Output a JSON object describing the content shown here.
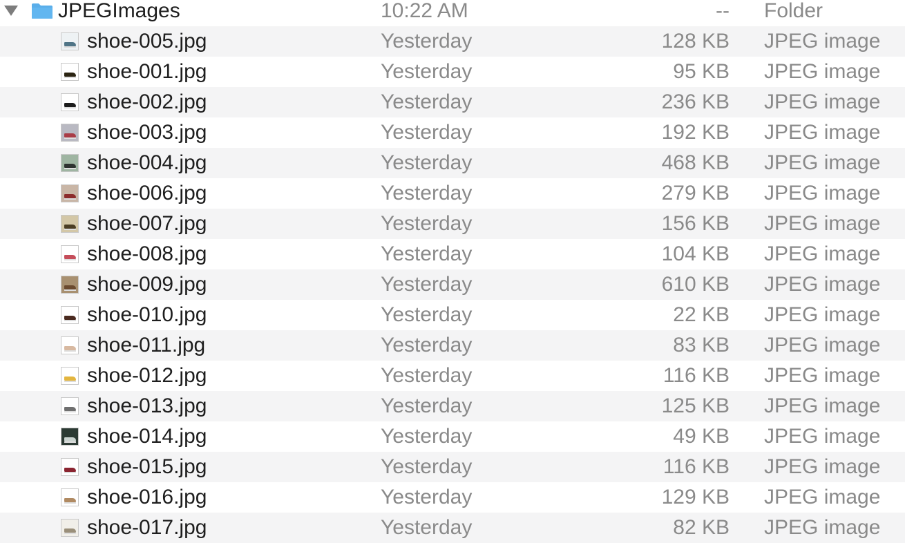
{
  "folder": {
    "name": "JPEGImages",
    "date": "10:22 AM",
    "size": "--",
    "kind": "Folder",
    "icon": "folder-icon",
    "icon_color": "#62b6f0"
  },
  "files": [
    {
      "name": "shoe-005.jpg",
      "date": "Yesterday",
      "size": "128 KB",
      "kind": "JPEG image",
      "thumb_bg": "#eef2f4",
      "thumb_color": "#4f7486"
    },
    {
      "name": "shoe-001.jpg",
      "date": "Yesterday",
      "size": "95 KB",
      "kind": "JPEG image",
      "thumb_bg": "#ffffff",
      "thumb_color": "#2b2412"
    },
    {
      "name": "shoe-002.jpg",
      "date": "Yesterday",
      "size": "236 KB",
      "kind": "JPEG image",
      "thumb_bg": "#ffffff",
      "thumb_color": "#1d1d1d"
    },
    {
      "name": "shoe-003.jpg",
      "date": "Yesterday",
      "size": "192 KB",
      "kind": "JPEG image",
      "thumb_bg": "#b9b9c2",
      "thumb_color": "#a93c46"
    },
    {
      "name": "shoe-004.jpg",
      "date": "Yesterday",
      "size": "468 KB",
      "kind": "JPEG image",
      "thumb_bg": "#9fb5a2",
      "thumb_color": "#2e3230"
    },
    {
      "name": "shoe-006.jpg",
      "date": "Yesterday",
      "size": "279 KB",
      "kind": "JPEG image",
      "thumb_bg": "#c9b6a6",
      "thumb_color": "#8c2c2c"
    },
    {
      "name": "shoe-007.jpg",
      "date": "Yesterday",
      "size": "156 KB",
      "kind": "JPEG image",
      "thumb_bg": "#d3c7a7",
      "thumb_color": "#4a3d24"
    },
    {
      "name": "shoe-008.jpg",
      "date": "Yesterday",
      "size": "104 KB",
      "kind": "JPEG image",
      "thumb_bg": "#ffffff",
      "thumb_color": "#c54d5a"
    },
    {
      "name": "shoe-009.jpg",
      "date": "Yesterday",
      "size": "610 KB",
      "kind": "JPEG image",
      "thumb_bg": "#a89070",
      "thumb_color": "#6b4a2f"
    },
    {
      "name": "shoe-010.jpg",
      "date": "Yesterday",
      "size": "22 KB",
      "kind": "JPEG image",
      "thumb_bg": "#ffffff",
      "thumb_color": "#4a2a1f"
    },
    {
      "name": "shoe-011.jpg",
      "date": "Yesterday",
      "size": "83 KB",
      "kind": "JPEG image",
      "thumb_bg": "#ffffff",
      "thumb_color": "#d8b9a1"
    },
    {
      "name": "shoe-012.jpg",
      "date": "Yesterday",
      "size": "116 KB",
      "kind": "JPEG image",
      "thumb_bg": "#ffffff",
      "thumb_color": "#e3b53e"
    },
    {
      "name": "shoe-013.jpg",
      "date": "Yesterday",
      "size": "125 KB",
      "kind": "JPEG image",
      "thumb_bg": "#ffffff",
      "thumb_color": "#6f6f6f"
    },
    {
      "name": "shoe-014.jpg",
      "date": "Yesterday",
      "size": "49 KB",
      "kind": "JPEG image",
      "thumb_bg": "#2b3a33",
      "thumb_color": "#c9d3cf"
    },
    {
      "name": "shoe-015.jpg",
      "date": "Yesterday",
      "size": "116 KB",
      "kind": "JPEG image",
      "thumb_bg": "#ffffff",
      "thumb_color": "#8a2430"
    },
    {
      "name": "shoe-016.jpg",
      "date": "Yesterday",
      "size": "129 KB",
      "kind": "JPEG image",
      "thumb_bg": "#ffffff",
      "thumb_color": "#b08a62"
    },
    {
      "name": "shoe-017.jpg",
      "date": "Yesterday",
      "size": "82 KB",
      "kind": "JPEG image",
      "thumb_bg": "#f1efe9",
      "thumb_color": "#9a8f7a"
    }
  ]
}
